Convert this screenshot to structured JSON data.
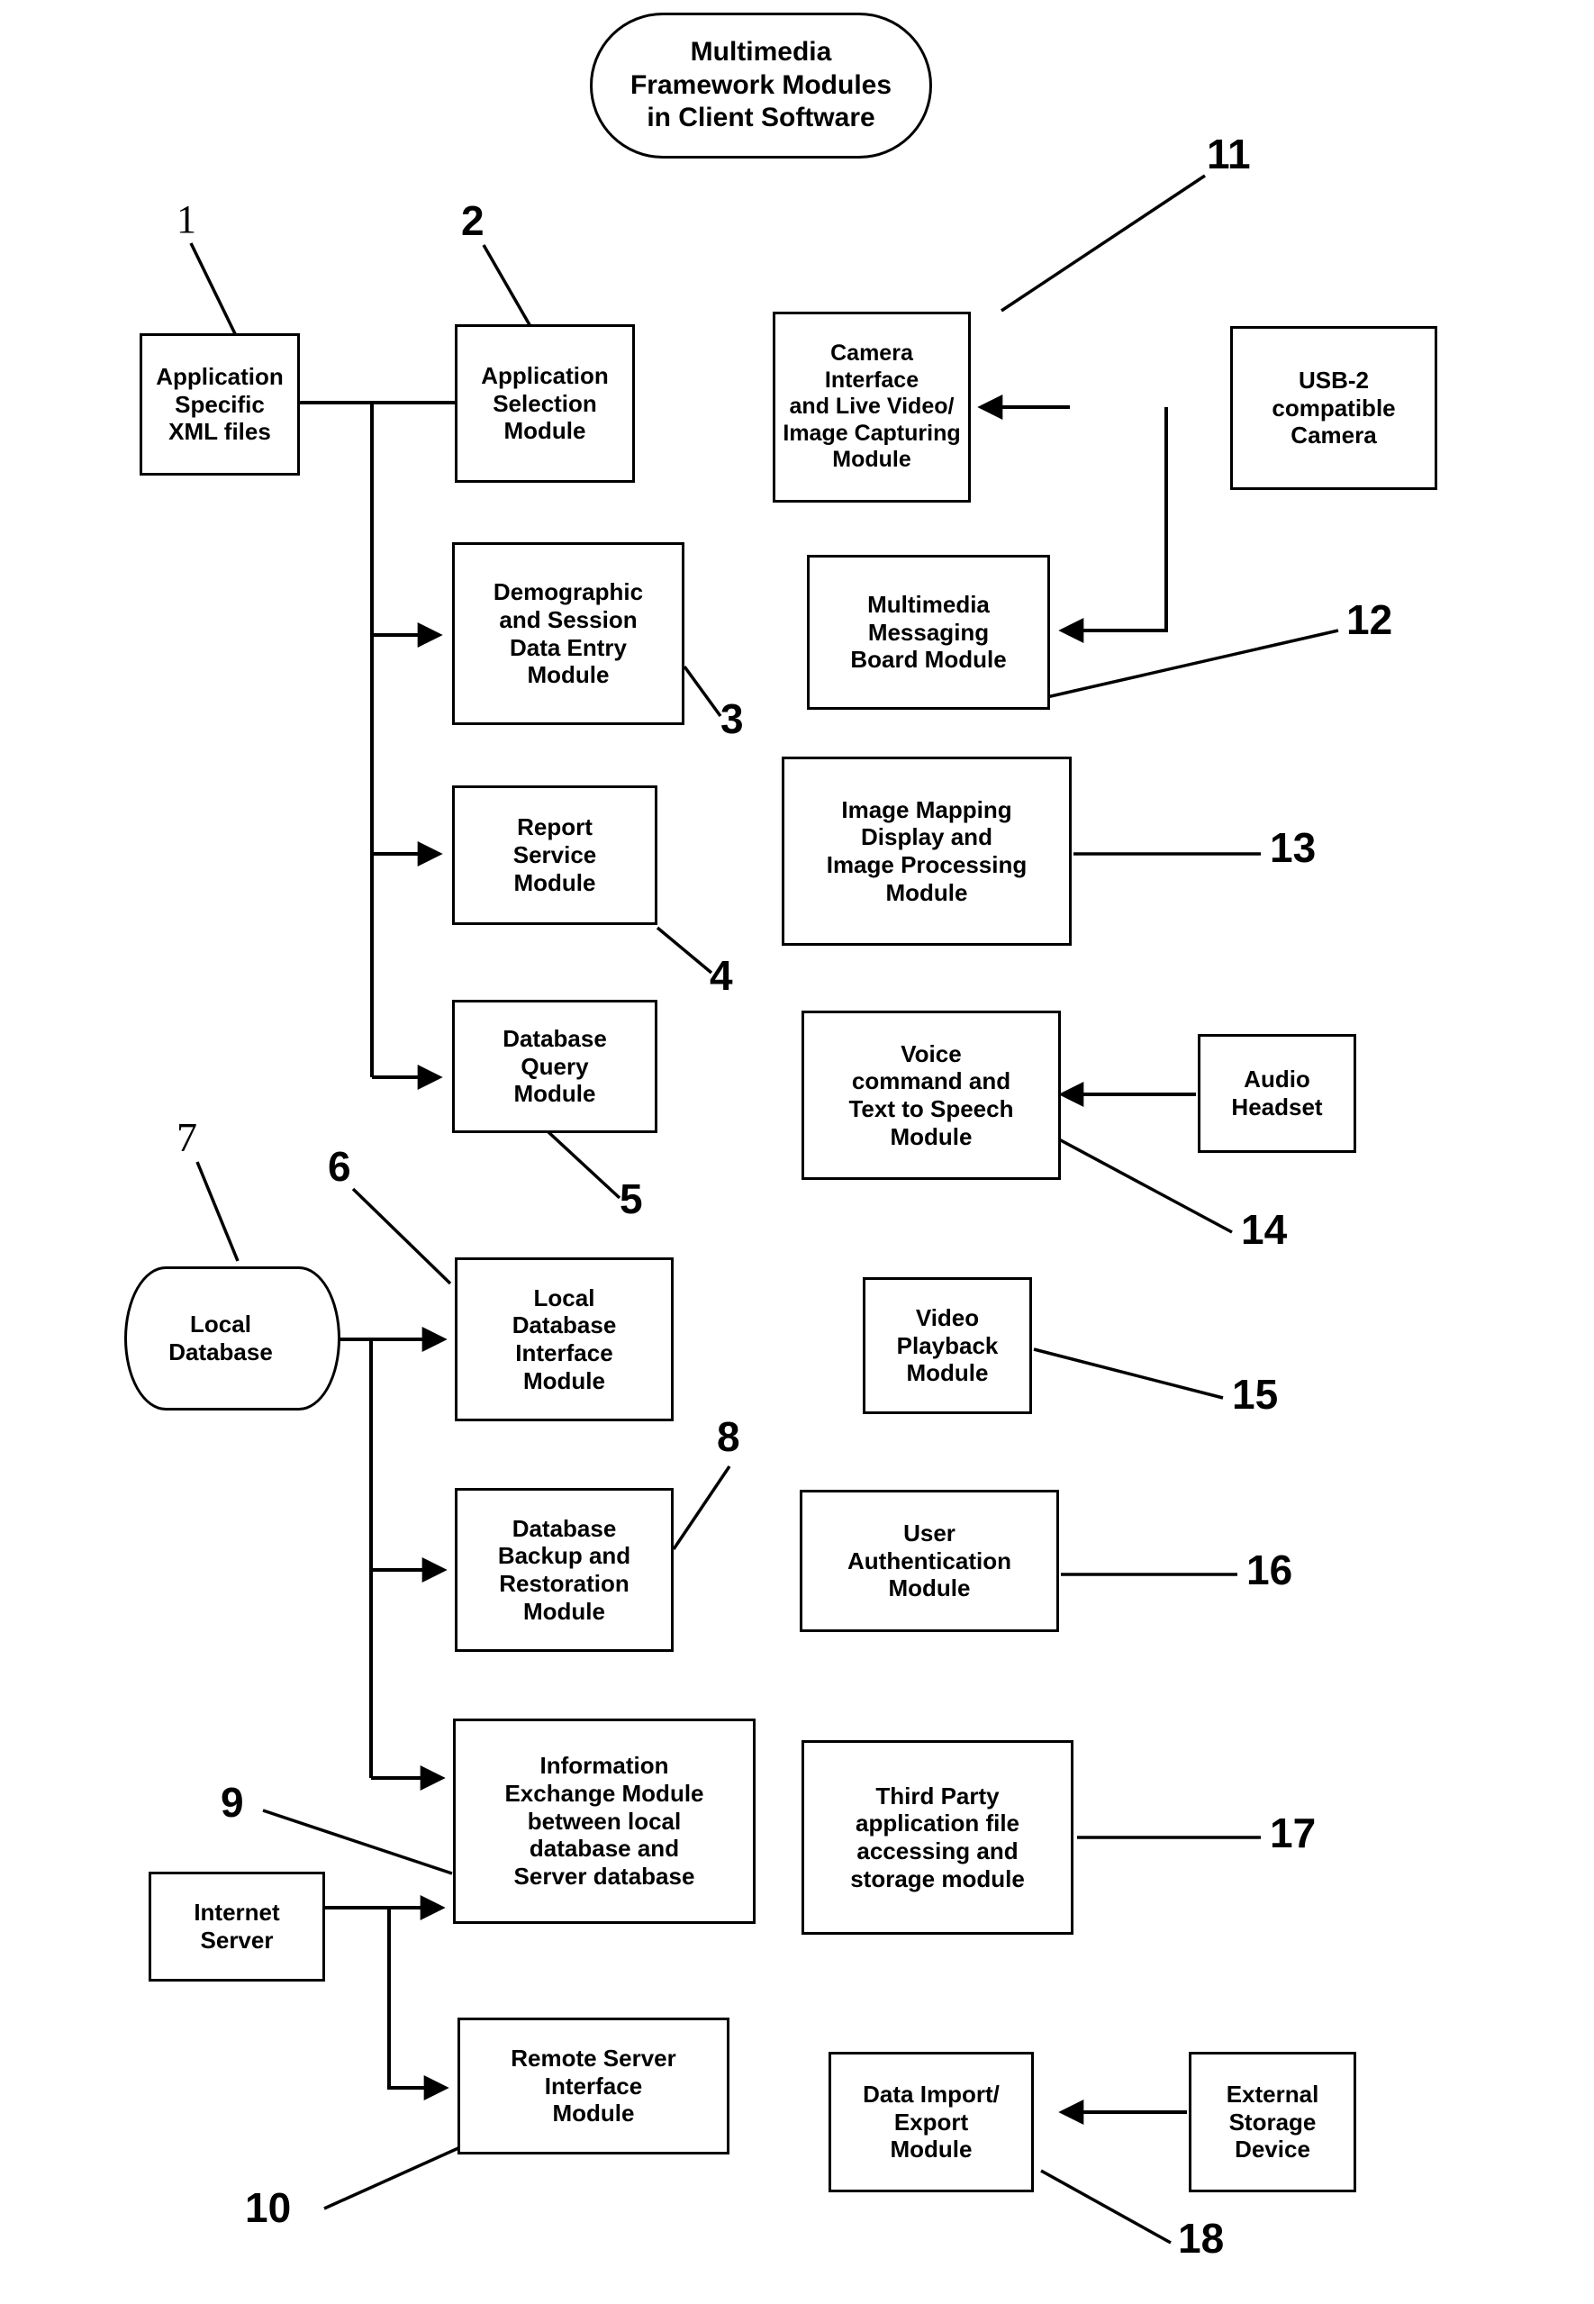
{
  "diagram": {
    "title": "Multimedia\nFramework Modules\nin Client Software",
    "line_color": "#000000",
    "background": "#ffffff"
  },
  "nodes": {
    "app_xml": "Application\nSpecific\nXML files",
    "app_selection": "Application\nSelection\nModule",
    "demographic": "Demographic\nand Session\nData Entry\nModule",
    "report_service": "Report\nService\nModule",
    "database_query": "Database\nQuery\nModule",
    "local_db": "Local\nDatabase",
    "local_db_interface": "Local\nDatabase\nInterface\nModule",
    "db_backup": "Database\nBackup and\nRestoration\nModule",
    "info_exchange": "Information\nExchange Module\nbetween local\ndatabase and\nServer database",
    "internet_server": "Internet\nServer",
    "remote_server": "Remote Server\nInterface\nModule",
    "camera_interface": "Camera Interface\nand Live Video/\nImage Capturing\nModule",
    "usb_camera": "USB-2\ncompatible\nCamera",
    "mm_messaging": "Multimedia\nMessaging\nBoard Module",
    "image_mapping": "Image Mapping\nDisplay and\nImage Processing\nModule",
    "voice_command": "Voice\ncommand and\nText to Speech\nModule",
    "audio_headset": "Audio\nHeadset",
    "video_playback": "Video\nPlayback\nModule",
    "user_auth": "User\nAuthentication\nModule",
    "third_party": "Third Party\napplication file\naccessing and\nstorage module",
    "data_import_export": "Data Import/\nExport\nModule",
    "external_storage": "External\nStorage\nDevice"
  },
  "reference_numerals": {
    "n1": "1",
    "n2": "2",
    "n3": "3",
    "n4": "4",
    "n5": "5",
    "n6": "6",
    "n7": "7",
    "n8": "8",
    "n9": "9",
    "n10": "10",
    "n11": "11",
    "n12": "12",
    "n13": "13",
    "n14": "14",
    "n15": "15",
    "n16": "16",
    "n17": "17",
    "n18": "18"
  }
}
